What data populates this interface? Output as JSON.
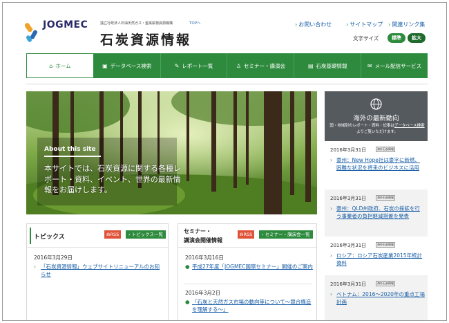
{
  "header": {
    "org_name": "JOGMEC",
    "org_subtitle": "独立行政法人石油天然ガス・金属鉱物資源機構",
    "home_link": "TOPへ",
    "site_title": "石炭資源情報",
    "utility_links": [
      "お問い合わせ",
      "サイトマップ",
      "関連リンク集"
    ],
    "font_size_label": "文字サイズ",
    "font_size_standard": "標準",
    "font_size_large": "拡大"
  },
  "nav": [
    {
      "icon": "⌂",
      "label": "ホーム",
      "active": true
    },
    {
      "icon": "▣",
      "label": "データベース検索"
    },
    {
      "icon": "✎",
      "label": "レポート一覧"
    },
    {
      "icon": "♙",
      "label": "セミナー・講演会"
    },
    {
      "icon": "▤",
      "label": "石炭基礎情報"
    },
    {
      "icon": "✉",
      "label": "メール配信サービス"
    }
  ],
  "hero": {
    "about_title": "About this site",
    "about_text": "本サイトでは、石炭資源に関する各種レポート・資料、イベント、世界の最新情報をお届けします。"
  },
  "overseas": {
    "title": "海外の最新動向",
    "desc_prefix": "国・地域別のレポート・資料・記事は",
    "desc_link": "データベース検索",
    "desc_suffix": "よりご覧いただけます。",
    "items": [
      {
        "date": "2016年3月31日",
        "badge": "海外石炭情報",
        "text": "豪州：New Hope社は豪字に新燃、困難な状況を将来のビジネスに活用"
      },
      {
        "date": "2016年3月31日",
        "badge": "海外石炭情報",
        "text": "豪州：QLD州政府、石炭の採鉱を行う事業者の負担軽減措置を発表"
      },
      {
        "date": "2016年3月31日",
        "badge": "海外石炭情報",
        "text": "ロシア：ロシア石炭産業2015年統計資料"
      },
      {
        "date": "2016年3月31日",
        "badge": "海外石炭情報",
        "text": "ベトナム：2016～2020年の重点工場計画"
      }
    ]
  },
  "topics": {
    "title": "トピックス",
    "rss": "RSS",
    "list_button": "トピックス一覧",
    "items": [
      {
        "date": "2016年3月29日",
        "text": "「石炭資源情報」ウェブサイトリニューアルのお知らせ"
      }
    ]
  },
  "seminar": {
    "title_line1": "セミナー・",
    "title_line2": "講演会開催情報",
    "rss": "RSS",
    "list_button": "セミナー・講演会一覧",
    "items": [
      {
        "date": "2016年3月16日",
        "text": "平成27年度「JOGMEC国際セミナー」開催のご案内"
      },
      {
        "date": "2016年3月2日",
        "text": "「石炭と天然ガス市場の動向等について～競合構造を理解する～」"
      }
    ]
  },
  "colors": {
    "brand_green": "#2e8b3e",
    "link_blue": "#1a5fa8",
    "rss_orange": "#e0533a",
    "panel_dark": "#555a5e"
  }
}
